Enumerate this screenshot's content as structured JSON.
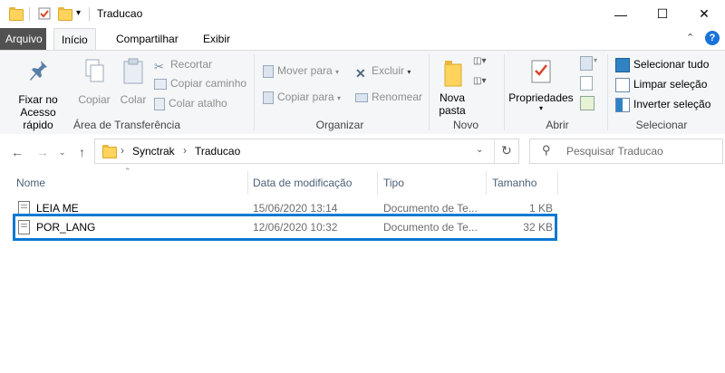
{
  "window": {
    "title": "Traducao"
  },
  "ribbon_tabs": [
    "Arquivo",
    "Início",
    "Compartilhar",
    "Exibir"
  ],
  "ribbon": {
    "pin": {
      "line1": "Fixar no",
      "line2": "Acesso rápido"
    },
    "copy": "Copiar",
    "paste": "Colar",
    "cut": "Recortar",
    "copy_path": "Copiar caminho",
    "paste_shortcut": "Colar atalho",
    "group_clipboard": "Área de Transferência",
    "move_to": "Mover para",
    "copy_to": "Copiar para",
    "delete": "Excluir",
    "rename": "Renomear",
    "group_organize": "Organizar",
    "new_folder": {
      "line1": "Nova",
      "line2": "pasta"
    },
    "group_new": "Novo",
    "properties": "Propriedades",
    "group_open": "Abrir",
    "select_all": "Selecionar tudo",
    "select_none": "Limpar seleção",
    "invert_selection": "Inverter seleção",
    "group_select": "Selecionar"
  },
  "address": {
    "crumbs": [
      "Synctrak",
      "Traducao"
    ]
  },
  "search": {
    "placeholder": "Pesquisar Traducao"
  },
  "columns": {
    "name": "Nome",
    "date": "Data de modificação",
    "type": "Tipo",
    "size": "Tamanho"
  },
  "files": [
    {
      "name": "LEIA ME",
      "date": "15/06/2020 13:14",
      "type": "Documento de Te...",
      "size": "1 KB"
    },
    {
      "name": "POR_LANG",
      "date": "12/06/2020 10:32",
      "type": "Documento de Te...",
      "size": "32 KB"
    }
  ],
  "colors": {
    "accent": "#0a79d1",
    "file_tab": "#515151"
  }
}
